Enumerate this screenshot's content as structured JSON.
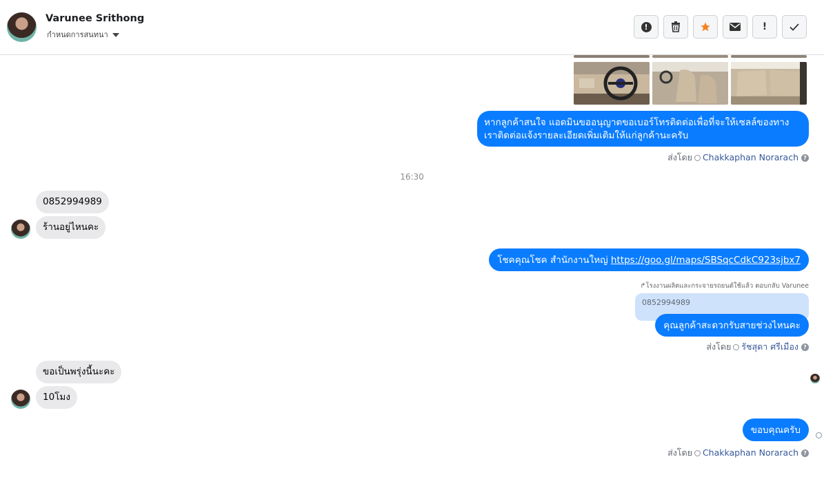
{
  "header": {
    "name": "Varunee Srithong",
    "subtitle": "กำหนดการสนทนา",
    "toolbar": [
      {
        "icon": "spam-icon",
        "glyph": "!"
      },
      {
        "icon": "trash-icon"
      },
      {
        "icon": "star-icon"
      },
      {
        "icon": "mail-icon"
      },
      {
        "icon": "exclaim-icon",
        "glyph": "!"
      },
      {
        "icon": "check-icon"
      }
    ]
  },
  "messages": {
    "out1": "หากลูกค้าสนใจ แอดมินขออนุญาตขอเบอร์โทรติดต่อเพื่อที่จะให้เซลล์ของทางเราติดต่อแจ้งรายละเอียดเพิ่มเติมให้แก่ลูกค้านะครับ",
    "sent1_prefix": "ส่งโดย",
    "sent1_name": "Chakkaphan Norarach",
    "time": "16:30",
    "in1": "0852994989",
    "in2": "ร้านอยู่ไหนคะ",
    "out2_text": "โชคคุณโชค สำนักงานใหญ่",
    "out2_link": "https://goo.gl/maps/SBSqcCdkC923sjbx7",
    "reply_note": "โรงงานผลิตและกระจายรถยนต์ใช้แล้ว ตอบกลับ Varunee",
    "reply_quote": "0852994989",
    "out3": "คุณลูกค้าสะดวกรับสายช่วงไหนคะ",
    "sent2_prefix": "ส่งโดย",
    "sent2_name": "รัชสุดา ศรีเมือง",
    "in3": "ขอเป็นพรุ่งนี้นะคะ",
    "in4": "10โมง",
    "out4": "ขอบคุณครับ",
    "sent3_prefix": "ส่งโดย",
    "sent3_name": "Chakkaphan Norarach"
  },
  "colors": {
    "outgoing": "#0a7cff",
    "incoming": "#e9e9eb",
    "star": "#f5821f"
  }
}
